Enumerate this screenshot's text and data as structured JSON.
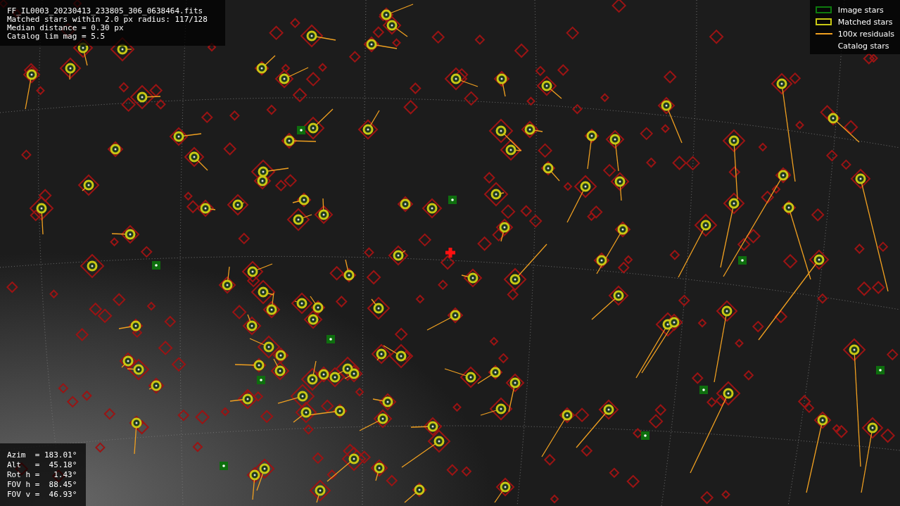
{
  "info": {
    "lines": [
      "FF_IL0003_20230413_233805_306_0638464.fits",
      "Matched stars within 2.0 px radius: 117/128",
      "Median distance = 0.30 px",
      "Catalog lim mag = 5.5"
    ]
  },
  "legend": [
    {
      "label": "Image stars",
      "kind": "box",
      "color": "#0e7a0e"
    },
    {
      "label": "Matched stars",
      "kind": "box",
      "color": "#c8c814"
    },
    {
      "label": "100x residuals",
      "kind": "line",
      "color": "#f0a020"
    },
    {
      "label": "Catalog stars",
      "kind": "none"
    }
  ],
  "pointing": {
    "lines": [
      "Azim  = 183.01°",
      "Alt   =  45.18°",
      "Rot h =   1.43°",
      "FOV h =  88.45°",
      "FOV v =  46.93°"
    ]
  }
}
